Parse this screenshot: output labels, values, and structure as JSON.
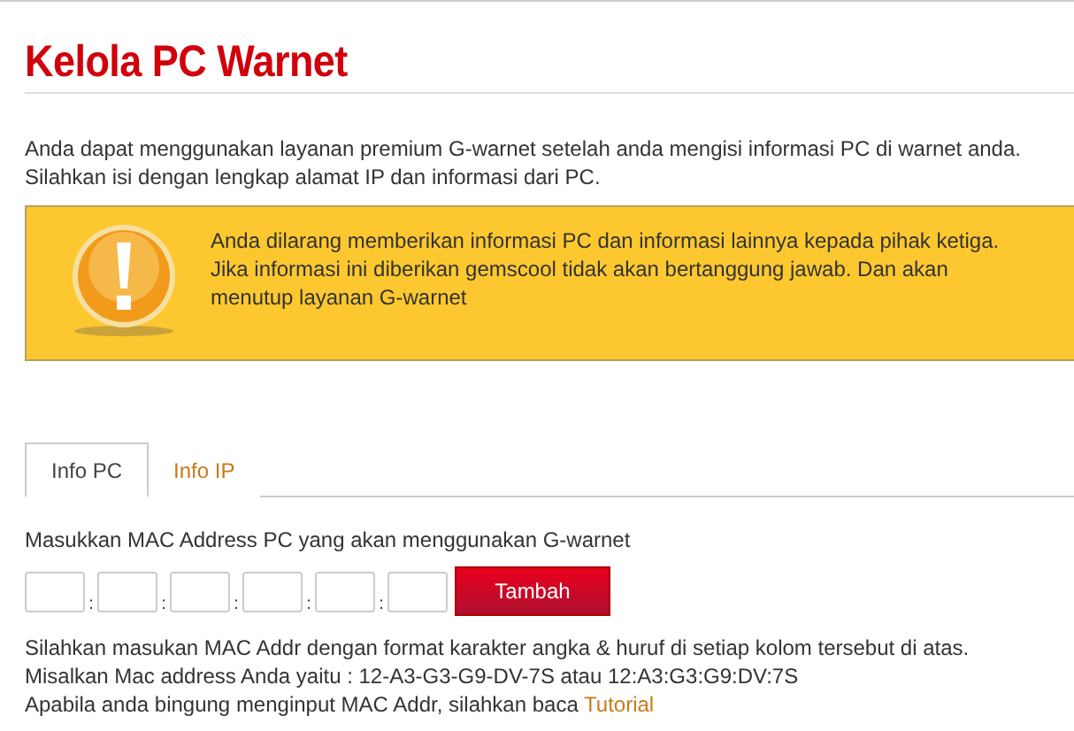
{
  "title": "Kelola PC Warnet",
  "intro": [
    "Anda dapat menggunakan layanan premium G-warnet setelah anda mengisi informasi PC di warnet anda.",
    "Silahkan isi dengan lengkap alamat IP dan informasi dari PC."
  ],
  "warning": {
    "lines": [
      "Anda dilarang memberikan informasi PC dan informasi lainnya kepada pihak ketiga.",
      "Jika informasi ini diberikan gemscool tidak akan bertanggung jawab. Dan akan",
      "menutup layanan G-warnet"
    ]
  },
  "tabs": [
    {
      "label": "Info PC",
      "selected": true
    },
    {
      "label": "Info IP",
      "selected": false
    }
  ],
  "mac_form": {
    "label": "Masukkan MAC Address PC yang akan menggunakan G-warnet",
    "separators": [
      ":",
      ":",
      ":",
      ":",
      ":"
    ],
    "button": "Tambah"
  },
  "help": {
    "lines": [
      "Silahkan masukan MAC Addr dengan format karakter angka & huruf di setiap kolom tersebut di atas.",
      "Misalkan Mac address Anda yaitu : 12-A3-G3-G9-DV-7S atau 12:A3:G3:G9:DV:7S"
    ],
    "last_line": "Apabila anda bingung menginput MAC Addr, silahkan baca",
    "link": "Tutorial"
  }
}
